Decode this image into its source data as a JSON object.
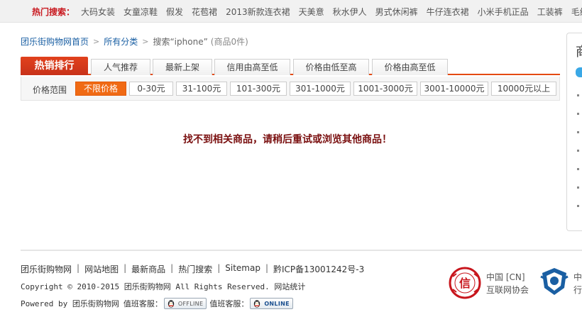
{
  "hot_search": {
    "label": "热门搜索：",
    "items": [
      "大码女装",
      "女童凉鞋",
      "假发",
      "花苞裙",
      "2013新款连衣裙",
      "天美意",
      "秋水伊人",
      "男式休闲裤",
      "牛仔连衣裙",
      "小米手机正品",
      "工装裤",
      "毛线"
    ]
  },
  "breadcrumb": {
    "home": "团乐街购物网首页",
    "category": "所有分类",
    "search": "搜索“iphone”",
    "count": "(商品0件)"
  },
  "sort_tabs": {
    "hot": "热销排行",
    "items": [
      "人气推荐",
      "最新上架",
      "信用由高至低",
      "价格由低至高",
      "价格由高至低"
    ]
  },
  "price_range": {
    "label": "价格范围",
    "options": [
      "不限价格",
      "0-30元",
      "31-100元",
      "101-300元",
      "301-1000元",
      "1001-3000元",
      "3001-10000元",
      "10000元以上"
    ],
    "selected": "不限价格"
  },
  "empty_message": "找不到相关商品，请稍后重试或浏览其他商品！",
  "side_panel": {
    "title": "商"
  },
  "footer": {
    "links": [
      "团乐街购物网",
      "网站地图",
      "最新商品",
      "热门搜索",
      "Sitemap",
      "黔ICP备13001242号-3"
    ],
    "copyright": "Copyright © 2010-2015 团乐街购物网 All Rights Reserved.",
    "stats": "网站统计",
    "powered_by": "Powered by 团乐街购物网",
    "service_label_1": "值班客服：",
    "qq_offline": "OFFLINE",
    "service_label_2": "值班客服：",
    "qq_online": "ONLINE"
  },
  "badges": {
    "cnnic_seal": "信",
    "cnnic_line1": "中国 [CN]",
    "cnnic_line2": "互联网协会",
    "police_line1": "中",
    "police_line2": "行"
  },
  "colors": {
    "accent_red": "#c8161d",
    "tab_underline": "#e44a12",
    "price_active": "#f06a14",
    "link_blue": "#1a5fa3"
  }
}
